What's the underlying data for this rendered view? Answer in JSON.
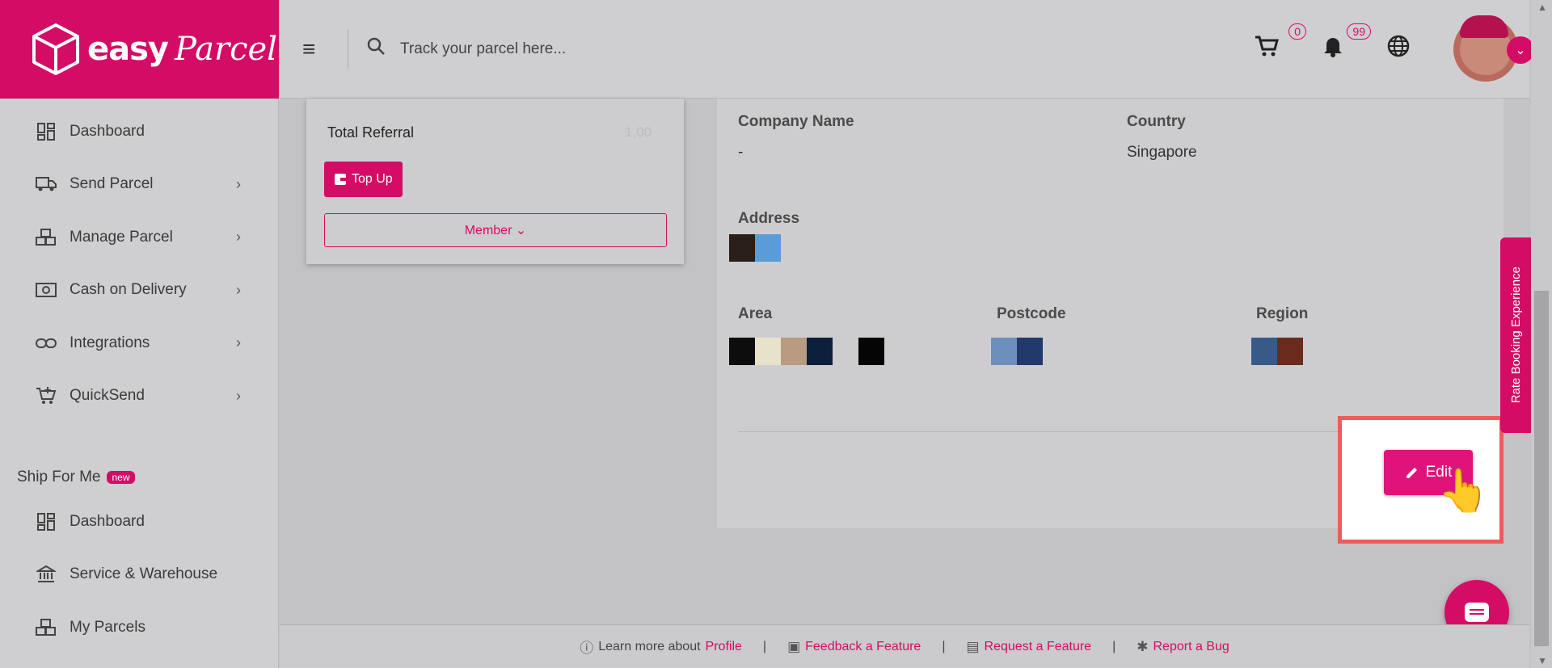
{
  "app": {
    "logo_text": "easy",
    "logo_script": "Parcel"
  },
  "topbar": {
    "search_placeholder": "Track your parcel here...",
    "cart_count": "0",
    "notification_count": "99"
  },
  "sidebar": {
    "items": [
      {
        "label": "Dashboard",
        "icon": "dashboard-icon",
        "has_children": false
      },
      {
        "label": "Send Parcel",
        "icon": "truck-icon",
        "has_children": true
      },
      {
        "label": "Manage Parcel",
        "icon": "boxes-icon",
        "has_children": true
      },
      {
        "label": "Cash on Delivery",
        "icon": "cash-icon",
        "has_children": true
      },
      {
        "label": "Integrations",
        "icon": "link-icon",
        "has_children": true
      },
      {
        "label": "QuickSend",
        "icon": "cart-plus-icon",
        "has_children": true
      }
    ],
    "ship_for_me": {
      "title": "Ship For Me",
      "badge": "new",
      "items": [
        {
          "label": "Dashboard",
          "icon": "dashboard-icon"
        },
        {
          "label": "Service & Warehouse",
          "icon": "bank-icon"
        },
        {
          "label": "My Parcels",
          "icon": "boxes-icon"
        }
      ]
    }
  },
  "left_card": {
    "total_referral_label": "Total Referral",
    "total_referral_value": "1,00",
    "topup_label": "Top Up",
    "member_label": "Member"
  },
  "profile": {
    "company_name_label": "Company Name",
    "company_name_value": "-",
    "country_label": "Country",
    "country_value": "Singapore",
    "address_label": "Address",
    "area_label": "Area",
    "postcode_label": "Postcode",
    "region_label": "Region",
    "edit_label": "Edit"
  },
  "rate_tab": {
    "label": "Rate Booking Experience"
  },
  "footer": {
    "learn_text": "Learn more about",
    "learn_link": "Profile",
    "feedback": "Feedback a Feature",
    "request": "Request a Feature",
    "bug": "Report a Bug",
    "separator": "|"
  },
  "colors": {
    "brand": "#d40c66",
    "highlight": "#ef5b5b"
  }
}
